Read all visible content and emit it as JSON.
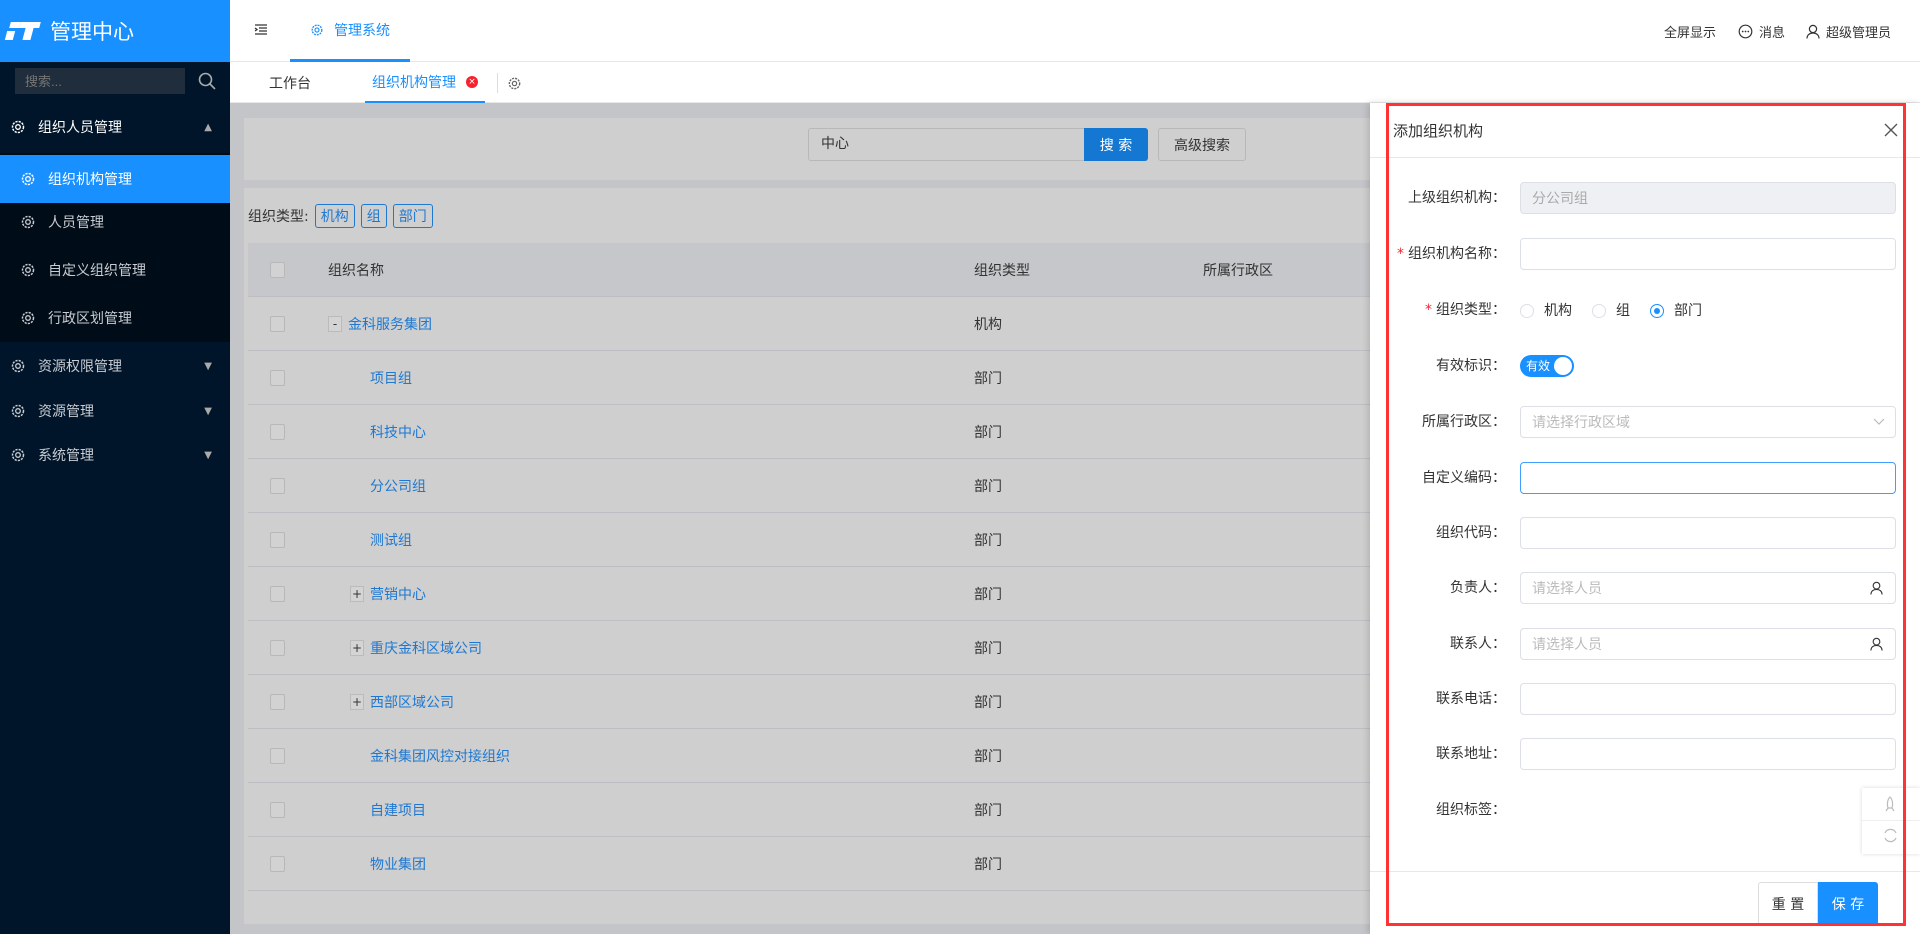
{
  "app": {
    "title": "管理中心",
    "search_placeholder": "搜索..."
  },
  "sidebar": {
    "groups": [
      {
        "label": "组织人员管理",
        "expanded": true,
        "items": [
          {
            "label": "组织机构管理",
            "active": true
          },
          {
            "label": "人员管理"
          },
          {
            "label": "自定义组织管理"
          },
          {
            "label": "行政区划管理"
          }
        ]
      },
      {
        "label": "资源权限管理",
        "expanded": false
      },
      {
        "label": "资源管理",
        "expanded": false
      },
      {
        "label": "系统管理",
        "expanded": false
      }
    ]
  },
  "header": {
    "system_tab": "管理系统",
    "fullscreen": "全屏显示",
    "messages": "消息",
    "user": "超级管理员"
  },
  "tabs": [
    {
      "label": "工作台"
    },
    {
      "label": "组织机构管理",
      "active": true
    }
  ],
  "search": {
    "value": "中心",
    "button": "搜 索",
    "advanced": "高级搜索"
  },
  "filter": {
    "label": "组织类型:",
    "tags": [
      "机构",
      "组",
      "部门"
    ]
  },
  "table": {
    "columns": [
      "组织名称",
      "组织类型",
      "所属行政区"
    ],
    "rows": [
      {
        "name": "金科服务集团",
        "type": "机构",
        "toggle": "-",
        "level": 0
      },
      {
        "name": "项目组",
        "type": "部门",
        "level": 1
      },
      {
        "name": "科技中心",
        "type": "部门",
        "level": 1
      },
      {
        "name": "分公司组",
        "type": "部门",
        "level": 1
      },
      {
        "name": "测试组",
        "type": "部门",
        "level": 1
      },
      {
        "name": "营销中心",
        "type": "部门",
        "toggle": "+",
        "level": 1
      },
      {
        "name": "重庆金科区域公司",
        "type": "部门",
        "toggle": "+",
        "level": 1
      },
      {
        "name": "西部区域公司",
        "type": "部门",
        "toggle": "+",
        "level": 1
      },
      {
        "name": "金科集团风控对接组织",
        "type": "部门",
        "level": 1
      },
      {
        "name": "自建项目",
        "type": "部门",
        "level": 1
      },
      {
        "name": "物业集团",
        "type": "部门",
        "level": 1
      }
    ]
  },
  "drawer": {
    "title": "添加组织机构",
    "fields": {
      "parent": {
        "label": "上级组织机构：",
        "value": "分公司组"
      },
      "name": {
        "label": "组织机构名称：",
        "required": true,
        "value": ""
      },
      "type": {
        "label": "组织类型：",
        "required": true,
        "options": [
          "机构",
          "组",
          "部门"
        ],
        "selected": "部门"
      },
      "valid": {
        "label": "有效标识：",
        "toggle_text": "有效",
        "on": true
      },
      "region": {
        "label": "所属行政区：",
        "placeholder": "请选择行政区域"
      },
      "custom_code": {
        "label": "自定义编码：",
        "value": ""
      },
      "org_code": {
        "label": "组织代码：",
        "value": ""
      },
      "owner": {
        "label": "负责人：",
        "placeholder": "请选择人员"
      },
      "contact": {
        "label": "联系人：",
        "placeholder": "请选择人员"
      },
      "phone": {
        "label": "联系电话：",
        "value": ""
      },
      "address": {
        "label": "联系地址：",
        "value": ""
      },
      "tags": {
        "label": "组织标签："
      }
    },
    "reset": "重 置",
    "save": "保 存"
  },
  "colors": {
    "primary": "#1890ff",
    "sidebar": "#001529",
    "highlight_border": "#ff3333"
  }
}
